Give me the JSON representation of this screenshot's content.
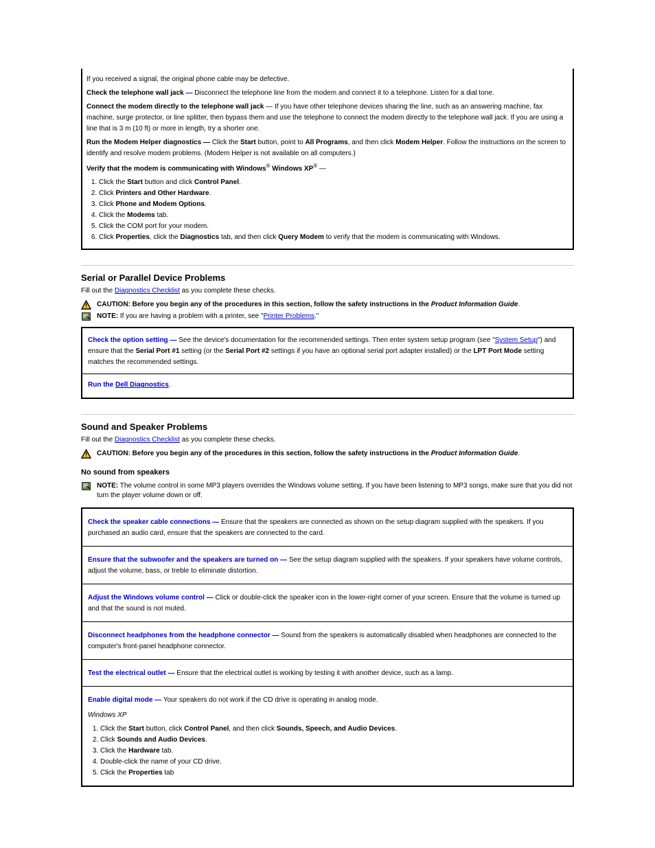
{
  "top_box": {
    "signal_line1": "If you received a signal, the original phone cable may be defective.",
    "network_b": "Check the telephone wall jack",
    "network_text": "Disconnect the telephone line from the modem and connect it to a telephone. Listen for a dial tone.",
    "network2_b": "Connect the modem directly to the telephone wall jack",
    "network2_text": "If you have other telephone devices sharing the line, such as an answering machine, fax machine, surge protector, or line splitter, then bypass them and use the telephone to connect the modem directly to the telephone wall jack. If you are using a line that is 3 m (10 ft) or more in length, try a shorter one.",
    "modem_b": "Run the Modem Helper diagnostics —",
    "modem_text1": "Click the ",
    "modem_start": "Start",
    "modem_text2": " button, point to ",
    "modem_all": "All Programs",
    "modem_text3": ", and then click ",
    "modem_helper": "Modem Helper",
    "modem_text4": ". Follow the instructions on the screen to identify and resolve modem problems. (Modem Helper is not available on all computers.)",
    "verify_b": "Verify that the modem is communicating with Windows",
    "verify_winxp": "Windows XP",
    "verify_li1_a": "Click the ",
    "verify_li1_b": " button and click ",
    "verify_li1_c": "Control Panel",
    "verify_li2_a": "Click ",
    "verify_li2_b": "Printers and Other Hardware",
    "verify_li3_a": "Click ",
    "verify_li3_b": "Phone and Modem Options",
    "verify_li4_a": "Click the ",
    "verify_li4_b": "Modems",
    "verify_li4_c": " tab.",
    "verify_li5": "Click the COM port for your modem.",
    "verify_li6_a": "Click ",
    "verify_li6_b": "Properties",
    "verify_li6_c": ", click the ",
    "verify_li6_d": "Diagnostics",
    "verify_li6_e": " tab, and then click ",
    "verify_li6_f": "Query Modem",
    "verify_li6_g": " to verify that the modem is communicating with Windows."
  },
  "serial": {
    "title": "Serial or Parallel Device Problems",
    "intro_a": "Fill out the ",
    "intro_link": "Diagnostics Checklist",
    "intro_b": " as you complete these checks.",
    "caution_b": "CAUTION: Before you begin any of the procedures in this section, follow the safety instructions in the ",
    "caution_i": "Product Information Guide",
    "note_b": "NOTE:",
    "note_t": " If you are having a problem with a printer, see \"",
    "note_link": "Printer Problems",
    "note_t2": ".\"",
    "box1_b": "Check the option setting —",
    "box1_t": "See the device's documentation for the recommended settings. Then enter system setup program (see \"",
    "box1_link": "System Setup",
    "box1_t2": "\") and ensure that the ",
    "box1_b2": "Serial Port #1",
    "box1_t3": " setting (or the ",
    "box1_b3": "Serial Port #2",
    "box1_t4": " settings if you have an optional serial port adapter installed) or the ",
    "box1_b4": "LPT Port Mode",
    "box1_t5": " setting matches the recommended settings.",
    "box2_a": "Run the ",
    "box2_link": "Dell Diagnostics",
    "box2_b": "."
  },
  "sound": {
    "title": "Sound and Speaker Problems",
    "intro_a": "Fill out the ",
    "intro_link": "Diagnostics Checklist",
    "intro_b": " as you complete these checks.",
    "caution_b": "CAUTION: Before you begin any of the procedures in this section, follow the safety instructions in the ",
    "caution_i": "Product Information Guide",
    "sub_h": "No sound from speakers",
    "note_b": "NOTE:",
    "note_t": " The volume control in some MP3 players overrides the Windows volume setting. If you have been listening to MP3 songs, make sure that you did not turn the player volume down or off.",
    "c1_b": "Check the speaker cable connections —",
    "c1_t": "Ensure that the speakers are connected as shown on the setup diagram supplied with the speakers. If you purchased an audio card, ensure that the speakers are connected to the card.",
    "c2_b": "Ensure that the subwoofer and the speakers are turned on —",
    "c2_t": "See the setup diagram supplied with the speakers. If your speakers have volume controls, adjust the volume, bass, or treble to eliminate distortion.",
    "c3_b": "Adjust the Windows volume control —",
    "c3_t": "Click or double-click the speaker icon in the lower-right corner of your screen. Ensure that the volume is turned up and that the sound is not muted.",
    "c4_b": "Disconnect headphones from the headphone connector —",
    "c4_t": "Sound from the speakers is automatically disabled when headphones are connected to the computer's front-panel headphone connector.",
    "c5_b": "Test the electrical outlet —",
    "c5_t": "Ensure that the electrical outlet is working by testing it with another device, such as a lamp.",
    "c6_b": "Enable digital mode —",
    "c6_t": "Your speakers do not work if the CD drive is operating in analog mode.",
    "c6_wxp": "Windows XP",
    "c6_li1_a": "Click the ",
    "c6_li1_b": "Start",
    "c6_li1_c": " button, click ",
    "c6_li1_d": "Control Panel",
    "c6_li1_e": ", and then click ",
    "c6_li1_f": "Sounds, Speech, and Audio Devices",
    "c6_li2_a": "Click ",
    "c6_li2_b": "Sounds and Audio Devices",
    "c6_li3_a": "Click the ",
    "c6_li3_b": "Hardware",
    "c6_li3_c": " tab.",
    "c6_li4": "Double-click the name of your CD drive.",
    "c6_li5_a": "Click the ",
    "c6_li5_b": "Properties",
    "c6_li5_c": " tab"
  }
}
